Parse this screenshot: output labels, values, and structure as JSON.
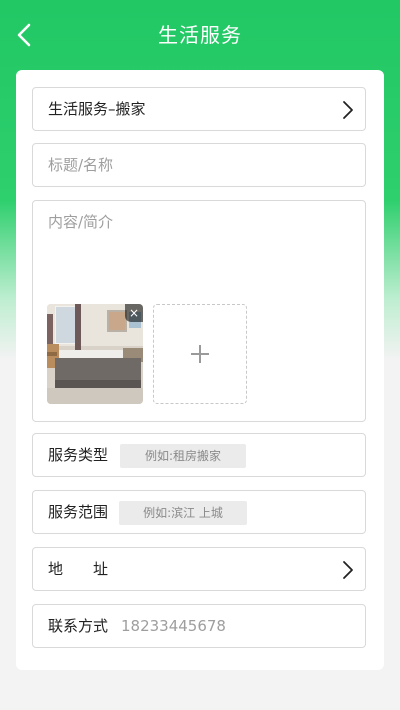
{
  "header": {
    "title": "生活服务"
  },
  "form": {
    "category_value": "生活服务–搬家",
    "title_placeholder": "标题/名称",
    "content_placeholder": "内容/简介",
    "image_close": "×",
    "service_type": {
      "label": "服务类型",
      "placeholder": "例如:租房搬家"
    },
    "service_scope": {
      "label": "服务范围",
      "placeholder": "例如:滨江 上城"
    },
    "address": {
      "label_first": "地",
      "label_second": "址"
    },
    "contact": {
      "label": "联系方式",
      "value": "18233445678"
    }
  },
  "icons": {
    "back": "back-arrow-icon",
    "chevron": "chevron-right-icon",
    "add": "plus-icon",
    "close": "close-icon"
  },
  "colors": {
    "header_green": "#21c864",
    "border": "#d9d9d9",
    "placeholder": "#9e9e9e"
  }
}
